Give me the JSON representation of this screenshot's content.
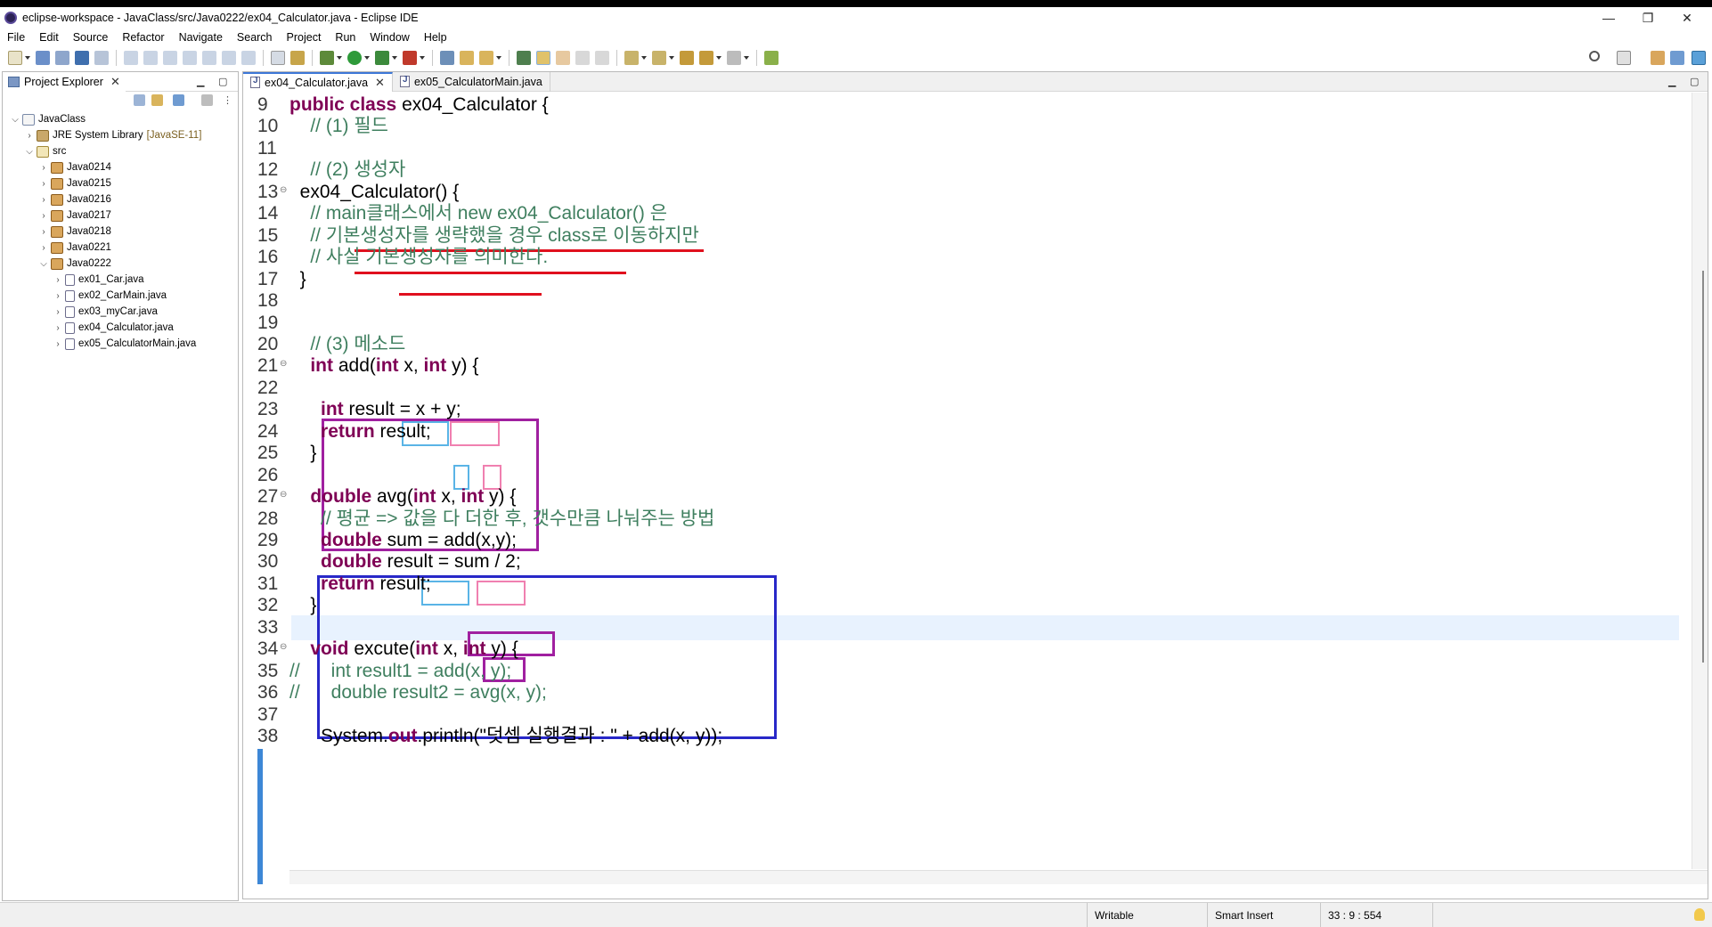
{
  "window": {
    "title": "eclipse-workspace - JavaClass/src/Java0222/ex04_Calculator.java - Eclipse IDE",
    "controls": [
      "—",
      "❐",
      "✕"
    ]
  },
  "menu": [
    "File",
    "Edit",
    "Source",
    "Refactor",
    "Navigate",
    "Search",
    "Project",
    "Run",
    "Window",
    "Help"
  ],
  "explorer": {
    "title": "Project Explorer",
    "tree": [
      {
        "label": "JavaClass",
        "level": 0,
        "expand": "open",
        "icon": "project-icon"
      },
      {
        "label": "JRE System Library",
        "extra": "[JavaSE-11]",
        "level": 1,
        "expand": "closed",
        "icon": "library-icon"
      },
      {
        "label": "src",
        "level": 1,
        "expand": "open",
        "icon": "source-folder-icon"
      },
      {
        "label": "Java0214",
        "level": 2,
        "expand": "closed",
        "icon": "package-icon"
      },
      {
        "label": "Java0215",
        "level": 2,
        "expand": "closed",
        "icon": "package-icon"
      },
      {
        "label": "Java0216",
        "level": 2,
        "expand": "closed",
        "icon": "package-icon"
      },
      {
        "label": "Java0217",
        "level": 2,
        "expand": "closed",
        "icon": "package-icon"
      },
      {
        "label": "Java0218",
        "level": 2,
        "expand": "closed",
        "icon": "package-icon"
      },
      {
        "label": "Java0221",
        "level": 2,
        "expand": "closed",
        "icon": "package-icon"
      },
      {
        "label": "Java0222",
        "level": 2,
        "expand": "open",
        "icon": "package-icon"
      },
      {
        "label": "ex01_Car.java",
        "level": 3,
        "expand": "closed",
        "icon": "java-file-icon"
      },
      {
        "label": "ex02_CarMain.java",
        "level": 3,
        "expand": "closed",
        "icon": "java-file-icon"
      },
      {
        "label": "ex03_myCar.java",
        "level": 3,
        "expand": "closed",
        "icon": "java-file-icon"
      },
      {
        "label": "ex04_Calculator.java",
        "level": 3,
        "expand": "closed",
        "icon": "java-file-icon"
      },
      {
        "label": "ex05_CalculatorMain.java",
        "level": 3,
        "expand": "closed",
        "icon": "java-file-icon"
      }
    ]
  },
  "editor": {
    "tabs": [
      {
        "label": "ex04_Calculator.java",
        "active": true
      },
      {
        "label": "ex05_CalculatorMain.java",
        "active": false
      }
    ],
    "lines": [
      {
        "n": "9",
        "tokens": [
          {
            "t": "public class ",
            "c": "kw"
          },
          {
            "t": "ex04_Calculator {",
            "c": "n"
          }
        ]
      },
      {
        "n": "10",
        "tokens": [
          {
            "t": "    // (1) 필드",
            "c": "cm"
          }
        ]
      },
      {
        "n": "11",
        "tokens": []
      },
      {
        "n": "12",
        "tokens": [
          {
            "t": "    // (2) 생성자",
            "c": "cm"
          }
        ]
      },
      {
        "n": "13",
        "fold": true,
        "tokens": [
          {
            "t": "  ex04_Calculator() {",
            "c": "n"
          }
        ]
      },
      {
        "n": "14",
        "tokens": [
          {
            "t": "    // main클래스에서 new ex04_Calculator() 은",
            "c": "cm"
          }
        ]
      },
      {
        "n": "15",
        "tokens": [
          {
            "t": "    // 기본생성자를 생략했을 경우 class로 이동하지만",
            "c": "cm"
          }
        ]
      },
      {
        "n": "16",
        "tokens": [
          {
            "t": "    // 사실 기본생성자를 의미한다.",
            "c": "cm"
          }
        ]
      },
      {
        "n": "17",
        "tokens": [
          {
            "t": "  }",
            "c": "n"
          }
        ]
      },
      {
        "n": "18",
        "tokens": []
      },
      {
        "n": "19",
        "tokens": []
      },
      {
        "n": "20",
        "tokens": [
          {
            "t": "    // (3) 메소드",
            "c": "cm"
          }
        ]
      },
      {
        "n": "21",
        "fold": true,
        "tokens": [
          {
            "t": "    ",
            "c": "n"
          },
          {
            "t": "int",
            "c": "kw"
          },
          {
            "t": " add(",
            "c": "n"
          },
          {
            "t": "int",
            "c": "kw"
          },
          {
            "t": " x, ",
            "c": "n"
          },
          {
            "t": "int",
            "c": "kw"
          },
          {
            "t": " y) {",
            "c": "n"
          }
        ]
      },
      {
        "n": "22",
        "tokens": []
      },
      {
        "n": "23",
        "tokens": [
          {
            "t": "      ",
            "c": "n"
          },
          {
            "t": "int",
            "c": "kw"
          },
          {
            "t": " result = x + y;",
            "c": "n"
          }
        ]
      },
      {
        "n": "24",
        "tokens": [
          {
            "t": "      ",
            "c": "n"
          },
          {
            "t": "return",
            "c": "kw"
          },
          {
            "t": " result;",
            "c": "n"
          }
        ]
      },
      {
        "n": "25",
        "tokens": [
          {
            "t": "    }",
            "c": "n"
          }
        ]
      },
      {
        "n": "26",
        "tokens": []
      },
      {
        "n": "27",
        "fold": true,
        "tokens": [
          {
            "t": "    ",
            "c": "n"
          },
          {
            "t": "double",
            "c": "kw"
          },
          {
            "t": " avg(",
            "c": "n"
          },
          {
            "t": "int",
            "c": "kw"
          },
          {
            "t": " x, ",
            "c": "n"
          },
          {
            "t": "int",
            "c": "kw"
          },
          {
            "t": " y) {",
            "c": "n"
          }
        ]
      },
      {
        "n": "28",
        "tokens": [
          {
            "t": "      // 평균 => 값을 다 더한 후, 갯수만큼 나눠주는 방법",
            "c": "cm"
          }
        ]
      },
      {
        "n": "29",
        "tokens": [
          {
            "t": "      ",
            "c": "n"
          },
          {
            "t": "double",
            "c": "kw"
          },
          {
            "t": " sum = add(x,y);",
            "c": "n"
          }
        ]
      },
      {
        "n": "30",
        "tokens": [
          {
            "t": "      ",
            "c": "n"
          },
          {
            "t": "double",
            "c": "kw"
          },
          {
            "t": " result = sum / 2;",
            "c": "n"
          }
        ]
      },
      {
        "n": "31",
        "tokens": [
          {
            "t": "      ",
            "c": "n"
          },
          {
            "t": "return",
            "c": "kw"
          },
          {
            "t": " result;",
            "c": "n"
          }
        ]
      },
      {
        "n": "32",
        "tokens": [
          {
            "t": "    }",
            "c": "n"
          }
        ]
      },
      {
        "n": "33",
        "tokens": [],
        "current": true
      },
      {
        "n": "34",
        "fold": true,
        "tokens": [
          {
            "t": "    ",
            "c": "n"
          },
          {
            "t": "void",
            "c": "kw"
          },
          {
            "t": " excute(",
            "c": "n"
          },
          {
            "t": "int",
            "c": "kw"
          },
          {
            "t": " x, ",
            "c": "n"
          },
          {
            "t": "int",
            "c": "kw"
          },
          {
            "t": " y) {",
            "c": "n"
          }
        ]
      },
      {
        "n": "35",
        "tokens": [
          {
            "t": "//      int result1 = add(x, y);",
            "c": "cm"
          }
        ]
      },
      {
        "n": "36",
        "tokens": [
          {
            "t": "//      double result2 = avg(x, y);",
            "c": "cm"
          }
        ]
      },
      {
        "n": "37",
        "tokens": []
      },
      {
        "n": "38",
        "tokens": [
          {
            "t": "      System.",
            "c": "n"
          },
          {
            "t": "out",
            "c": "kw"
          },
          {
            "t": ".println(\"덧셈 실행결과 : \" + add(x, y));",
            "c": "n"
          }
        ]
      }
    ]
  },
  "status": {
    "writable": "Writable",
    "insert_mode": "Smart Insert",
    "position": "33 : 9 : 554"
  },
  "colors": {
    "keyword": "#7f0055",
    "comment": "#3f7f5f",
    "annotation_purple": "#a020a0",
    "annotation_blue": "#2828c8",
    "annotation_cyan": "#5ab4e6",
    "annotation_pink": "#f080b0",
    "annotation_red": "#e0101e"
  }
}
